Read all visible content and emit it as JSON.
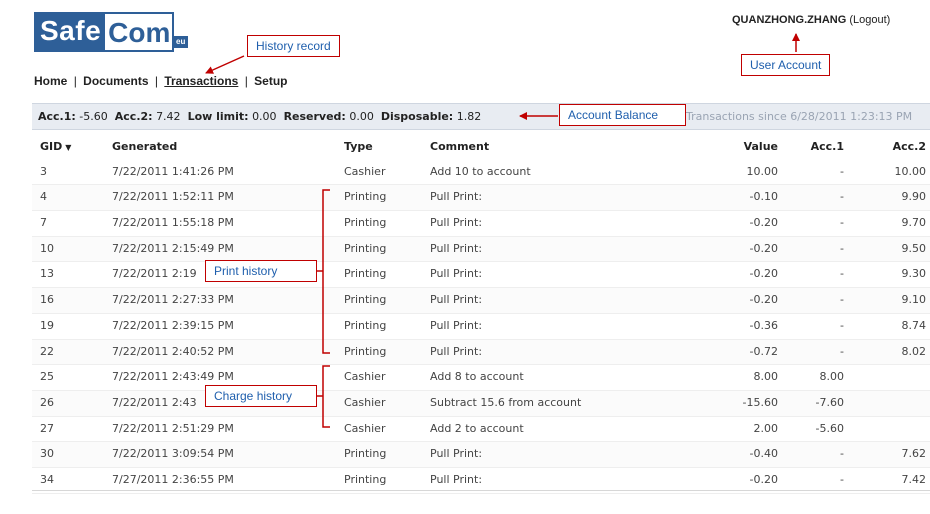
{
  "logo": {
    "part1": "Safe",
    "part2": "Com",
    "suffix": "eu"
  },
  "nav": {
    "items": [
      {
        "label": "Home"
      },
      {
        "label": "Documents"
      },
      {
        "label": "Transactions"
      },
      {
        "label": "Setup"
      }
    ],
    "separator": "|"
  },
  "user": {
    "name": "QUANZHONG.ZHANG",
    "logout": "(Logout)"
  },
  "balance": {
    "acc1_label": "Acc.1:",
    "acc1_value": "-5.60",
    "acc2_label": "Acc.2:",
    "acc2_value": "7.42",
    "low_limit_label": "Low limit:",
    "low_limit_value": "0.00",
    "reserved_label": "Reserved:",
    "reserved_value": "0.00",
    "disposable_label": "Disposable:",
    "disposable_value": "1.82",
    "since_text": "Transactions since 6/28/2011 1:23:13 PM"
  },
  "table": {
    "headers": {
      "gid": "GID",
      "generated": "Generated",
      "type": "Type",
      "comment": "Comment",
      "value": "Value",
      "acc1": "Acc.1",
      "acc2": "Acc.2"
    },
    "rows": [
      {
        "gid": "3",
        "generated": "7/22/2011 1:41:26 PM",
        "type": "Cashier",
        "comment": "Add 10 to account",
        "value": "10.00",
        "acc1": "-",
        "acc2": "10.00"
      },
      {
        "gid": "4",
        "generated": "7/22/2011 1:52:11 PM",
        "type": "Printing",
        "comment": "Pull Print:",
        "value": "-0.10",
        "acc1": "-",
        "acc2": "9.90"
      },
      {
        "gid": "7",
        "generated": "7/22/2011 1:55:18 PM",
        "type": "Printing",
        "comment": "Pull Print:",
        "value": "-0.20",
        "acc1": "-",
        "acc2": "9.70"
      },
      {
        "gid": "10",
        "generated": "7/22/2011 2:15:49 PM",
        "type": "Printing",
        "comment": "Pull Print:",
        "value": "-0.20",
        "acc1": "-",
        "acc2": "9.50"
      },
      {
        "gid": "13",
        "generated": "7/22/2011 2:19",
        "type": "Printing",
        "comment": "Pull Print:",
        "value": "-0.20",
        "acc1": "-",
        "acc2": "9.30"
      },
      {
        "gid": "16",
        "generated": "7/22/2011 2:27:33 PM",
        "type": "Printing",
        "comment": "Pull Print:",
        "value": "-0.20",
        "acc1": "-",
        "acc2": "9.10"
      },
      {
        "gid": "19",
        "generated": "7/22/2011 2:39:15 PM",
        "type": "Printing",
        "comment": "Pull Print:",
        "value": "-0.36",
        "acc1": "-",
        "acc2": "8.74"
      },
      {
        "gid": "22",
        "generated": "7/22/2011 2:40:52 PM",
        "type": "Printing",
        "comment": "Pull Print:",
        "value": "-0.72",
        "acc1": "-",
        "acc2": "8.02"
      },
      {
        "gid": "25",
        "generated": "7/22/2011 2:43:49 PM",
        "type": "Cashier",
        "comment": "Add 8 to account",
        "value": "8.00",
        "acc1": "8.00",
        "acc2": ""
      },
      {
        "gid": "26",
        "generated": "7/22/2011 2:43",
        "type": "Cashier",
        "comment": "Subtract 15.6 from account",
        "value": "-15.60",
        "acc1": "-7.60",
        "acc2": ""
      },
      {
        "gid": "27",
        "generated": "7/22/2011 2:51:29 PM",
        "type": "Cashier",
        "comment": "Add 2 to account",
        "value": "2.00",
        "acc1": "-5.60",
        "acc2": ""
      },
      {
        "gid": "30",
        "generated": "7/22/2011 3:09:54 PM",
        "type": "Printing",
        "comment": "Pull Print:",
        "value": "-0.40",
        "acc1": "-",
        "acc2": "7.62"
      },
      {
        "gid": "34",
        "generated": "7/27/2011 2:36:55 PM",
        "type": "Printing",
        "comment": "Pull Print:",
        "value": "-0.20",
        "acc1": "-",
        "acc2": "7.42"
      }
    ]
  },
  "annotations": {
    "history_record": "History record",
    "user_account": "User Account",
    "account_balance": "Account Balance",
    "print_history": "Print history",
    "charge_history": "Charge history"
  },
  "colors": {
    "brand": "#2e5f98",
    "annotation_border": "#c00000",
    "annotation_text": "#1f5fad",
    "balance_bar": "#e8ecf2"
  },
  "icons": {
    "sort": "sort-down-icon"
  }
}
